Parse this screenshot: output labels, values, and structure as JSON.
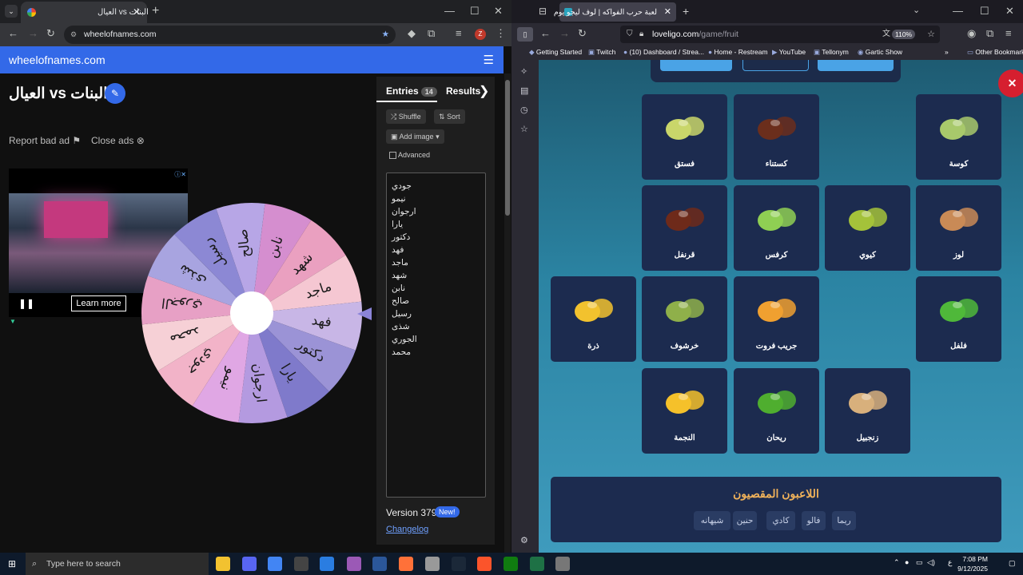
{
  "left_browser": {
    "tab_title": "العيال vs البنات",
    "url": "wheelofnames.com",
    "site_brand": "wheelofnames.com",
    "wheel_title": "البنات vs العيال",
    "report_label": "Report bad ad",
    "close_ads_label": "Close ads",
    "ad_button": "Learn more",
    "tabs": {
      "entries": "Entries",
      "entries_count": "14",
      "results": "Results"
    },
    "buttons": {
      "shuffle": "Shuffle",
      "sort": "Sort",
      "add_image": "Add image",
      "advanced": "Advanced"
    },
    "entries": [
      "جودي",
      "نيمو",
      "ارجوان",
      "يارا",
      "دكتور",
      "فهد",
      "ماجد",
      "شهد",
      "نابن",
      "صالح",
      "رسيل",
      "شذى",
      "الجوري",
      "محمد"
    ],
    "version": "Version 379",
    "new_badge": "New!",
    "changelog": "Changelog"
  },
  "wheel": {
    "segment_count": 14,
    "colors": [
      "#d58ecf",
      "#eaa0c0",
      "#f5c7d2",
      "#c8b6e6",
      "#9b93d6",
      "#7f7acb",
      "#b49ae0",
      "#e0a7e4",
      "#f2b3c8",
      "#f6d0d6",
      "#e7a0c5",
      "#a8a4e0",
      "#8c88d4",
      "#b7a6e6"
    ],
    "labels": [
      "نابن",
      "شهد",
      "ماجد",
      "فهد",
      "دكتور",
      "يارا",
      "ارجوان",
      "نيمو",
      "جودي",
      "محمد",
      "الجوري",
      "شذى",
      "رسيل",
      "صالح"
    ]
  },
  "right_browser": {
    "tab_title": "لعبة حرب الفواكه | لوف ليجو يوم",
    "url_host": "loveligo.com",
    "url_path": "/game/fruit",
    "zoom": "110%",
    "bookmarks": [
      "Getting Started",
      "Twitch",
      "(10) Dashboard / Strea...",
      "Home - Restream",
      "YouTube",
      "Tellonym",
      "Gartic Show",
      "Other Bookmarks"
    ],
    "cards": [
      {
        "name": "فستق",
        "pic": "pistachio",
        "color": "#c9d66a"
      },
      {
        "name": "كستناء",
        "pic": "chestnut",
        "color": "#6b2e1c"
      },
      {
        "name": "كوسة",
        "pic": "zucchini",
        "color": "#a8c96b"
      },
      {
        "name": "قرنفل",
        "pic": "clove",
        "color": "#6e2a1a"
      },
      {
        "name": "كرفس",
        "pic": "celery",
        "color": "#8fcf53"
      },
      {
        "name": "كيوي",
        "pic": "kiwi",
        "color": "#a4c23a"
      },
      {
        "name": "لوز",
        "pic": "almond",
        "color": "#c98a56"
      },
      {
        "name": "ذرة",
        "pic": "corn",
        "color": "#f2c22e"
      },
      {
        "name": "خرشوف",
        "pic": "artichoke",
        "color": "#8fb04a"
      },
      {
        "name": "جريب فروت",
        "pic": "grapefruit",
        "color": "#f0a030"
      },
      {
        "name": "فلفل",
        "pic": "pepper",
        "color": "#4fb83a"
      },
      {
        "name": "النجمة",
        "pic": "starfruit",
        "color": "#f5c12a"
      },
      {
        "name": "ريحان",
        "pic": "basil",
        "color": "#4fae2f"
      },
      {
        "name": "زنجبيل",
        "pic": "ginger",
        "color": "#d8b07c"
      }
    ],
    "eliminated_title": "اللاعبون المقصيون",
    "eliminated": [
      "ريما",
      "فالو",
      "كادي",
      "حنين",
      "شيهانه"
    ]
  },
  "taskbar": {
    "search_placeholder": "Type here to search",
    "time": "7:08 PM",
    "date": "9/12/2025",
    "lang": "ع"
  }
}
